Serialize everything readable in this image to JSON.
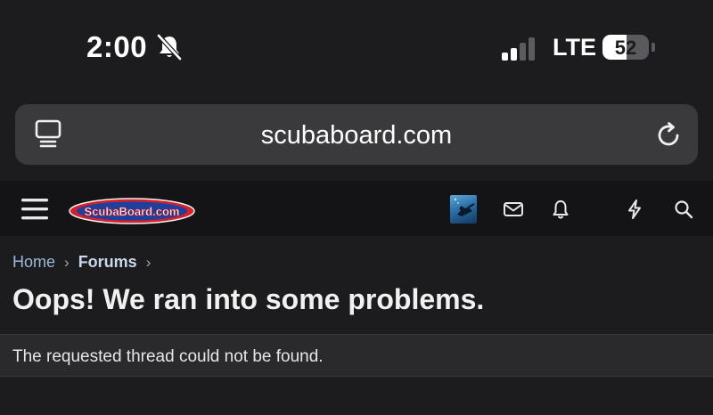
{
  "status_bar": {
    "time": "2:00",
    "network": "LTE",
    "battery_percent": "52",
    "battery_level": 0.52,
    "signal_bars_active": 2,
    "signal_bars_total": 4,
    "icons": [
      "bell-slash-icon",
      "signal-icon",
      "battery-icon"
    ]
  },
  "browser": {
    "url": "scubaboard.com",
    "icons": [
      "reader-mode-icon",
      "reload-icon"
    ]
  },
  "site_header": {
    "logo_text": "ScubaBoard.com",
    "icons": [
      "menu-icon",
      "avatar",
      "mail-icon",
      "bell-icon",
      "lightning-icon",
      "search-icon"
    ],
    "colors": {
      "logo_red": "#d4202a",
      "logo_blue": "#1f3f9c"
    }
  },
  "breadcrumb": {
    "items": [
      {
        "label": "Home"
      },
      {
        "label": "Forums"
      }
    ]
  },
  "page": {
    "title": "Oops! We ran into some problems.",
    "error_message": "The requested thread could not be found."
  }
}
